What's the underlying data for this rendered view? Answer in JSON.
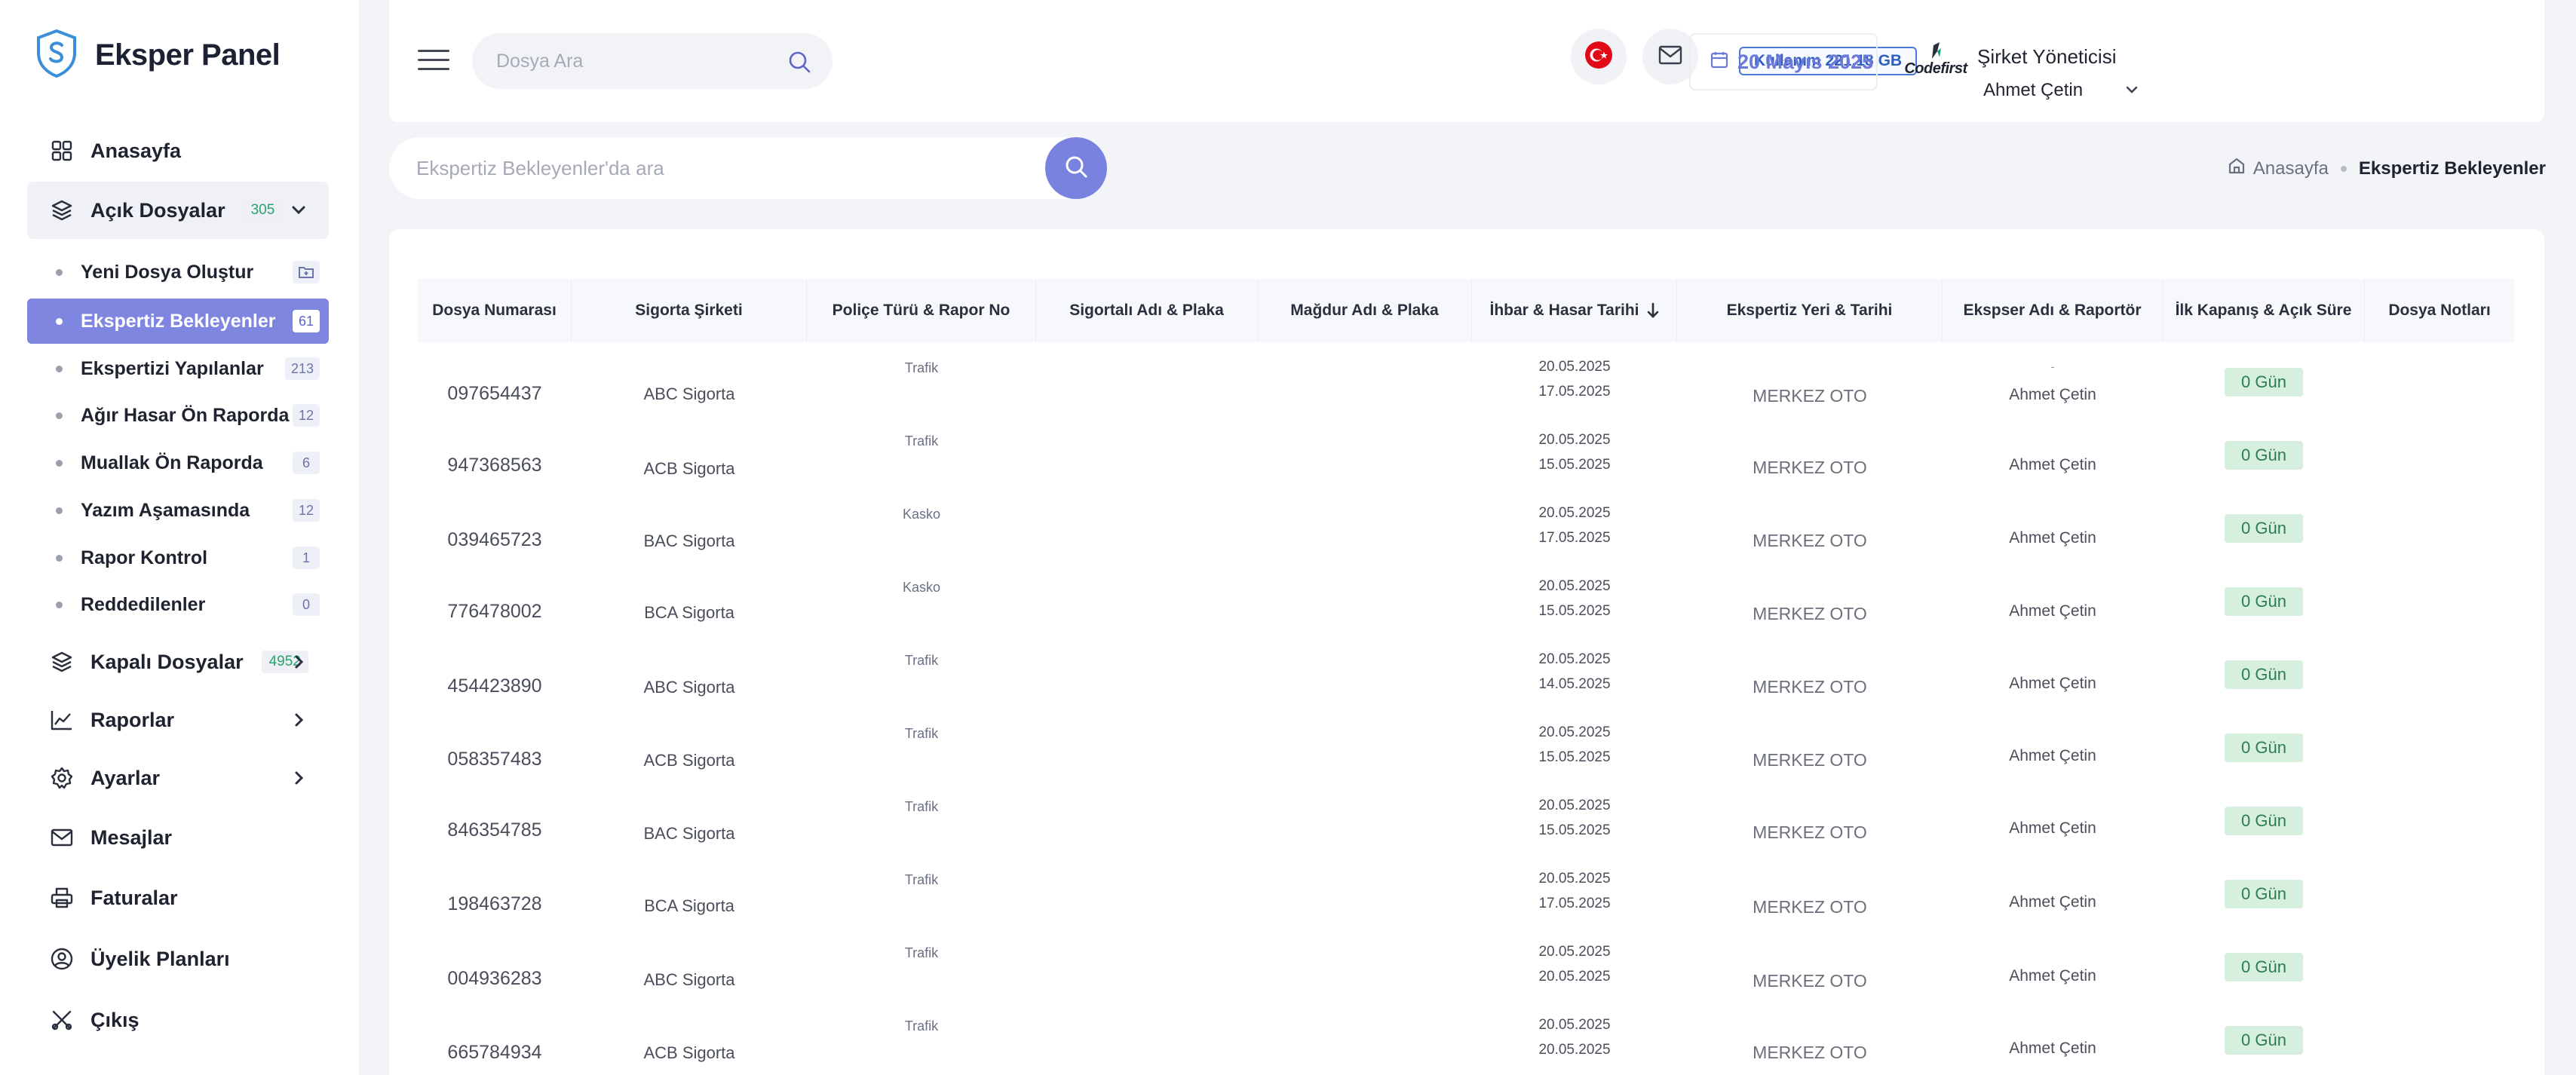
{
  "brand": {
    "title": "Eksper Panel"
  },
  "sidebar": {
    "items": [
      {
        "label": "Anasayfa",
        "icon": "grid-icon"
      },
      {
        "label": "Açık Dosyalar",
        "badge": "305",
        "icon": "layers-icon"
      },
      {
        "label": "Kapalı Dosyalar",
        "badge": "4952",
        "icon": "layers-icon"
      },
      {
        "label": "Raporlar",
        "icon": "chart-line-icon"
      },
      {
        "label": "Ayarlar",
        "icon": "gear-icon"
      },
      {
        "label": "Mesajlar",
        "icon": "mail-icon"
      },
      {
        "label": "Faturalar",
        "icon": "printer-icon"
      },
      {
        "label": "Üyelik Planları",
        "icon": "user-circle-icon"
      },
      {
        "label": "Çıkış",
        "icon": "logout-icon"
      }
    ],
    "sub_items": [
      {
        "label": "Yeni Dosya Oluştur"
      },
      {
        "label": "Ekspertiz Bekleyenler",
        "badge": "61"
      },
      {
        "label": "Ekspertizi Yapılanlar",
        "badge": "213"
      },
      {
        "label": "Ağır Hasar Ön Raporda",
        "badge": "12"
      },
      {
        "label": "Muallak Ön Raporda",
        "badge": "6"
      },
      {
        "label": "Yazım Aşamasında",
        "badge": "12"
      },
      {
        "label": "Rapor Kontrol",
        "badge": "1"
      },
      {
        "label": "Reddedilenler",
        "badge": "0"
      }
    ]
  },
  "header": {
    "search_placeholder": "Dosya Ara",
    "usage": "Kullanım 221,18 GB",
    "date": "20 Mayıs 2025",
    "company_logo": "Codefirst",
    "user_role": "Şirket Yöneticisi",
    "user_name": "Ahmet Çetin"
  },
  "subheader": {
    "search_placeholder": "Ekspertiz Bekleyenler'da ara",
    "breadcrumb_home": "Anasayfa",
    "breadcrumb_current": "Ekspertiz Bekleyenler"
  },
  "table": {
    "columns": [
      "Dosya Numarası",
      "Sigorta Şirketi",
      "Poliçe Türü & Rapor No",
      "Sigortalı Adı & Plaka",
      "Mağdur Adı & Plaka",
      "İhbar & Hasar Tarihi",
      "Ekspertiz Yeri & Tarihi",
      "Ekspser Adı & Raportör",
      "İlk Kapanış & Açık Süre",
      "Dosya Notları"
    ],
    "rows": [
      {
        "no": "097654437",
        "company": "ABC Sigorta",
        "type": "Trafik",
        "ihbar": "20.05.2025",
        "hasar": "17.05.2025",
        "place": "MERKEZ OTO",
        "dash": "-",
        "expert": "Ahmet Çetin",
        "duration": "0 Gün"
      },
      {
        "no": "947368563",
        "company": "ACB Sigorta",
        "type": "Trafik",
        "ihbar": "20.05.2025",
        "hasar": "15.05.2025",
        "place": "MERKEZ OTO",
        "dash": "",
        "expert": "Ahmet Çetin",
        "duration": "0 Gün"
      },
      {
        "no": "039465723",
        "company": "BAC Sigorta",
        "type": "Kasko",
        "ihbar": "20.05.2025",
        "hasar": "17.05.2025",
        "place": "MERKEZ OTO",
        "dash": "",
        "expert": "Ahmet Çetin",
        "duration": "0 Gün"
      },
      {
        "no": "776478002",
        "company": "BCA Sigorta",
        "type": "Kasko",
        "ihbar": "20.05.2025",
        "hasar": "15.05.2025",
        "place": "MERKEZ OTO",
        "dash": "",
        "expert": "Ahmet Çetin",
        "duration": "0 Gün"
      },
      {
        "no": "454423890",
        "company": "ABC Sigorta",
        "type": "Trafik",
        "ihbar": "20.05.2025",
        "hasar": "14.05.2025",
        "place": "MERKEZ OTO",
        "dash": "",
        "expert": "Ahmet Çetin",
        "duration": "0 Gün"
      },
      {
        "no": "058357483",
        "company": "ACB Sigorta",
        "type": "Trafik",
        "ihbar": "20.05.2025",
        "hasar": "15.05.2025",
        "place": "MERKEZ OTO",
        "dash": "",
        "expert": "Ahmet Çetin",
        "duration": "0 Gün"
      },
      {
        "no": "846354785",
        "company": "BAC Sigorta",
        "type": "Trafik",
        "ihbar": "20.05.2025",
        "hasar": "15.05.2025",
        "place": "MERKEZ OTO",
        "dash": "",
        "expert": "Ahmet Çetin",
        "duration": "0 Gün"
      },
      {
        "no": "198463728",
        "company": "BCA Sigorta",
        "type": "Trafik",
        "ihbar": "20.05.2025",
        "hasar": "17.05.2025",
        "place": "MERKEZ OTO",
        "dash": "",
        "expert": "Ahmet Çetin",
        "duration": "0 Gün"
      },
      {
        "no": "004936283",
        "company": "ABC Sigorta",
        "type": "Trafik",
        "ihbar": "20.05.2025",
        "hasar": "20.05.2025",
        "place": "MERKEZ OTO",
        "dash": "",
        "expert": "Ahmet Çetin",
        "duration": "0 Gün"
      },
      {
        "no": "665784934",
        "company": "ACB Sigorta",
        "type": "Trafik",
        "ihbar": "20.05.2025",
        "hasar": "20.05.2025",
        "place": "MERKEZ OTO",
        "dash": "",
        "expert": "Ahmet Çetin",
        "duration": "0 Gün"
      }
    ]
  },
  "colors": {
    "accent": "#7f86e0",
    "success_bg": "#d6efdf",
    "success_text": "#2f7d4f",
    "usage_border": "#4a7bd6"
  }
}
